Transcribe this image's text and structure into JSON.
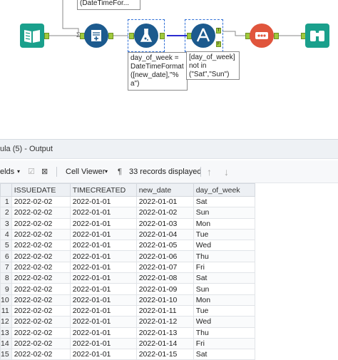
{
  "canvas": {
    "annotations": {
      "top_clip": "(DateTimeFor...",
      "formula": "day_of_week =\nDateTimeFormat\n([new_date],\"%\na\")",
      "filter": "[day_of_week]\nnot in\n(\"Sat\",\"Sun\")"
    },
    "filter_anchor_true": "T",
    "filter_anchor_false": "F",
    "connector_sigma": "Σ"
  },
  "output_panel": {
    "title": "ula (5) - Output",
    "toolbar": {
      "fields_label": "elds",
      "cell_viewer_label": "Cell Viewer",
      "pilcrow": "¶",
      "records_label": "33 records displayed"
    },
    "columns": [
      "ISSUEDATE",
      "TIMECREATED",
      "new_date",
      "day_of_week"
    ],
    "rows": [
      {
        "n": "1",
        "c": [
          "2022-02-02",
          "2022-01-01",
          "2022-01-01",
          "Sat"
        ]
      },
      {
        "n": "2",
        "c": [
          "2022-02-02",
          "2022-01-01",
          "2022-01-02",
          "Sun"
        ]
      },
      {
        "n": "3",
        "c": [
          "2022-02-02",
          "2022-01-01",
          "2022-01-03",
          "Mon"
        ]
      },
      {
        "n": "4",
        "c": [
          "2022-02-02",
          "2022-01-01",
          "2022-01-04",
          "Tue"
        ]
      },
      {
        "n": "5",
        "c": [
          "2022-02-02",
          "2022-01-01",
          "2022-01-05",
          "Wed"
        ]
      },
      {
        "n": "6",
        "c": [
          "2022-02-02",
          "2022-01-01",
          "2022-01-06",
          "Thu"
        ]
      },
      {
        "n": "7",
        "c": [
          "2022-02-02",
          "2022-01-01",
          "2022-01-07",
          "Fri"
        ]
      },
      {
        "n": "8",
        "c": [
          "2022-02-02",
          "2022-01-01",
          "2022-01-08",
          "Sat"
        ]
      },
      {
        "n": "9",
        "c": [
          "2022-02-02",
          "2022-01-01",
          "2022-01-09",
          "Sun"
        ]
      },
      {
        "n": "10",
        "c": [
          "2022-02-02",
          "2022-01-01",
          "2022-01-10",
          "Mon"
        ]
      },
      {
        "n": "11",
        "c": [
          "2022-02-02",
          "2022-01-01",
          "2022-01-11",
          "Tue"
        ]
      },
      {
        "n": "12",
        "c": [
          "2022-02-02",
          "2022-01-01",
          "2022-01-12",
          "Wed"
        ]
      },
      {
        "n": "13",
        "c": [
          "2022-02-02",
          "2022-01-01",
          "2022-01-13",
          "Thu"
        ]
      },
      {
        "n": "14",
        "c": [
          "2022-02-02",
          "2022-01-01",
          "2022-01-14",
          "Fri"
        ]
      },
      {
        "n": "15",
        "c": [
          "2022-02-02",
          "2022-01-01",
          "2022-01-15",
          "Sat"
        ]
      }
    ]
  },
  "colors": {
    "input_tool": "#1aa08c",
    "summarize_tool": "#1c5a8e",
    "formula_tool": "#1c5a8e",
    "filter_tool": "#1c5a8e",
    "sample_tool": "#e0553c",
    "browse_tool": "#1aa08c",
    "anchor": "#9fc93c",
    "selection": "#2f6fd6",
    "connection": "#888888",
    "selected_connection": "#2b2bd0"
  }
}
